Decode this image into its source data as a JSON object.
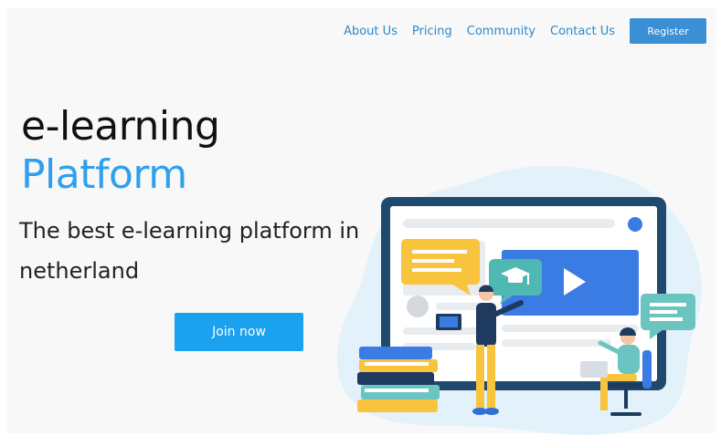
{
  "nav": {
    "links": [
      "About Us",
      "Pricing",
      "Community",
      "Contact Us"
    ],
    "register_label": "Register"
  },
  "hero": {
    "title_line1": "e-learning",
    "title_line2": "Platform",
    "subtitle": "The best e-learning platform in netherland",
    "cta_label": "Join now"
  },
  "colors": {
    "accent": "#2ea0ec",
    "button": "#1aa1ef",
    "nav_link": "#2f88c8"
  },
  "illustration": {
    "icons": [
      "graduation-cap-icon",
      "play-icon",
      "chat-bubble-icon",
      "laptop-icon",
      "book-stack-icon"
    ]
  }
}
